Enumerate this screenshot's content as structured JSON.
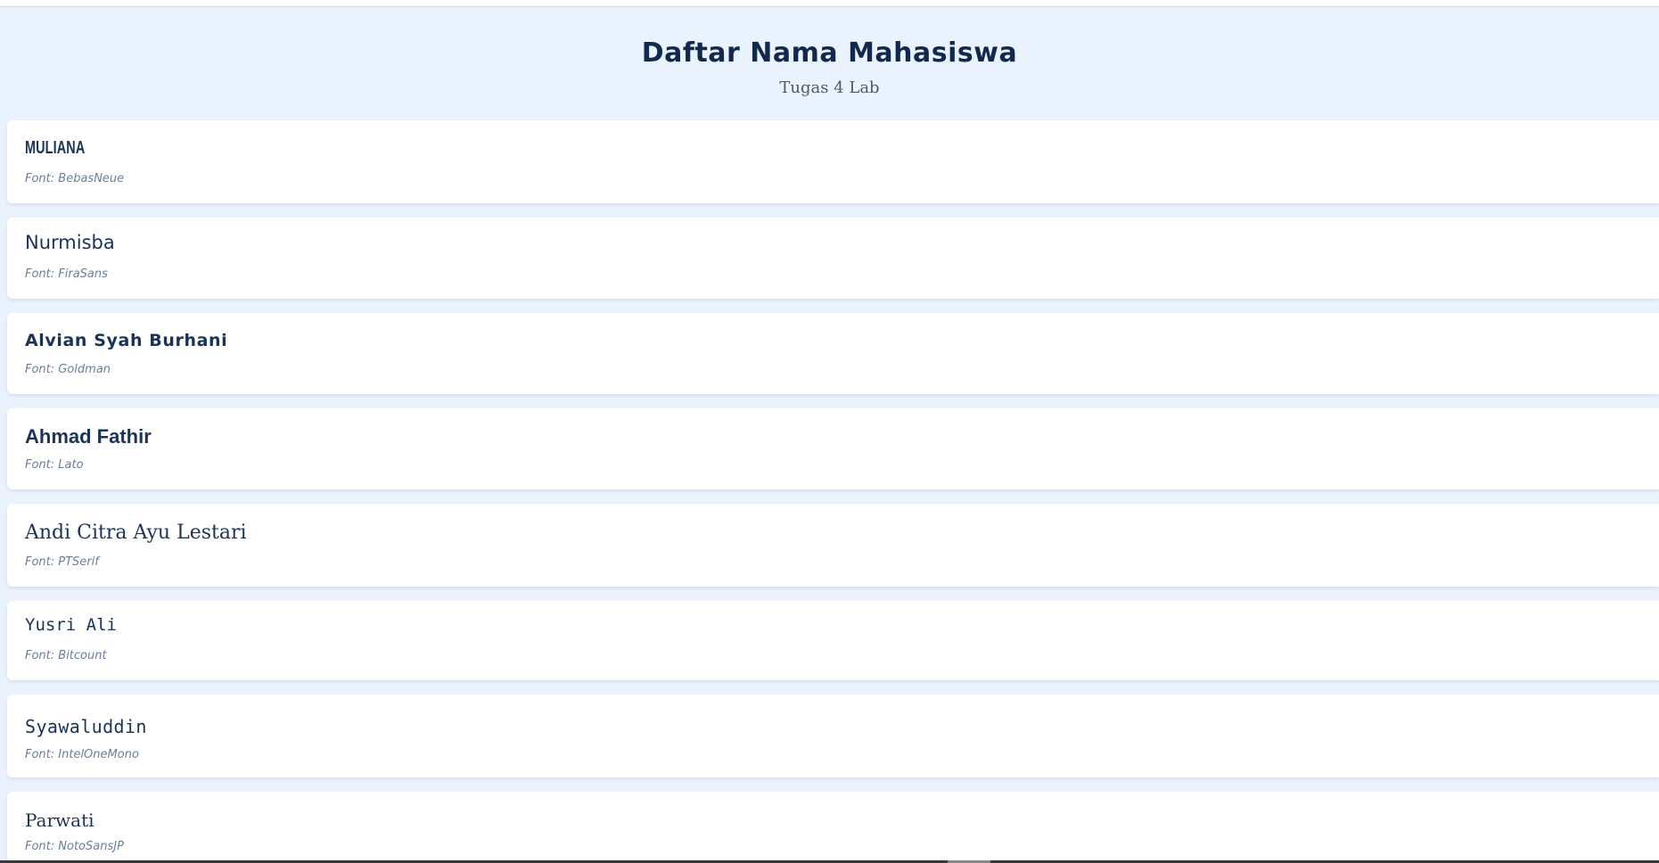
{
  "header": {
    "title": "Daftar Nama Mahasiswa",
    "subtitle": "Tugas 4 Lab"
  },
  "students": [
    {
      "name": "MULIANA",
      "font_label": "Font: BebasNeue"
    },
    {
      "name": "Nurmisba",
      "font_label": "Font: FiraSans"
    },
    {
      "name": "Alvian Syah Burhani",
      "font_label": "Font: Goldman"
    },
    {
      "name": "Ahmad Fathir",
      "font_label": "Font: Lato"
    },
    {
      "name": "Andi Citra Ayu Lestari",
      "font_label": "Font: PTSerif"
    },
    {
      "name": "Yusri Ali",
      "font_label": "Font: Bitcount"
    },
    {
      "name": "Syawaluddin",
      "font_label": "Font: IntelOneMono"
    },
    {
      "name": "Parwati",
      "font_label": "Font: NotoSansJP"
    }
  ],
  "colors": {
    "page_background": "#eaf2fd",
    "card_background": "#ffffff",
    "title_text": "#13294b",
    "name_text": "#1b3354",
    "font_label_text": "#6b7f99"
  }
}
